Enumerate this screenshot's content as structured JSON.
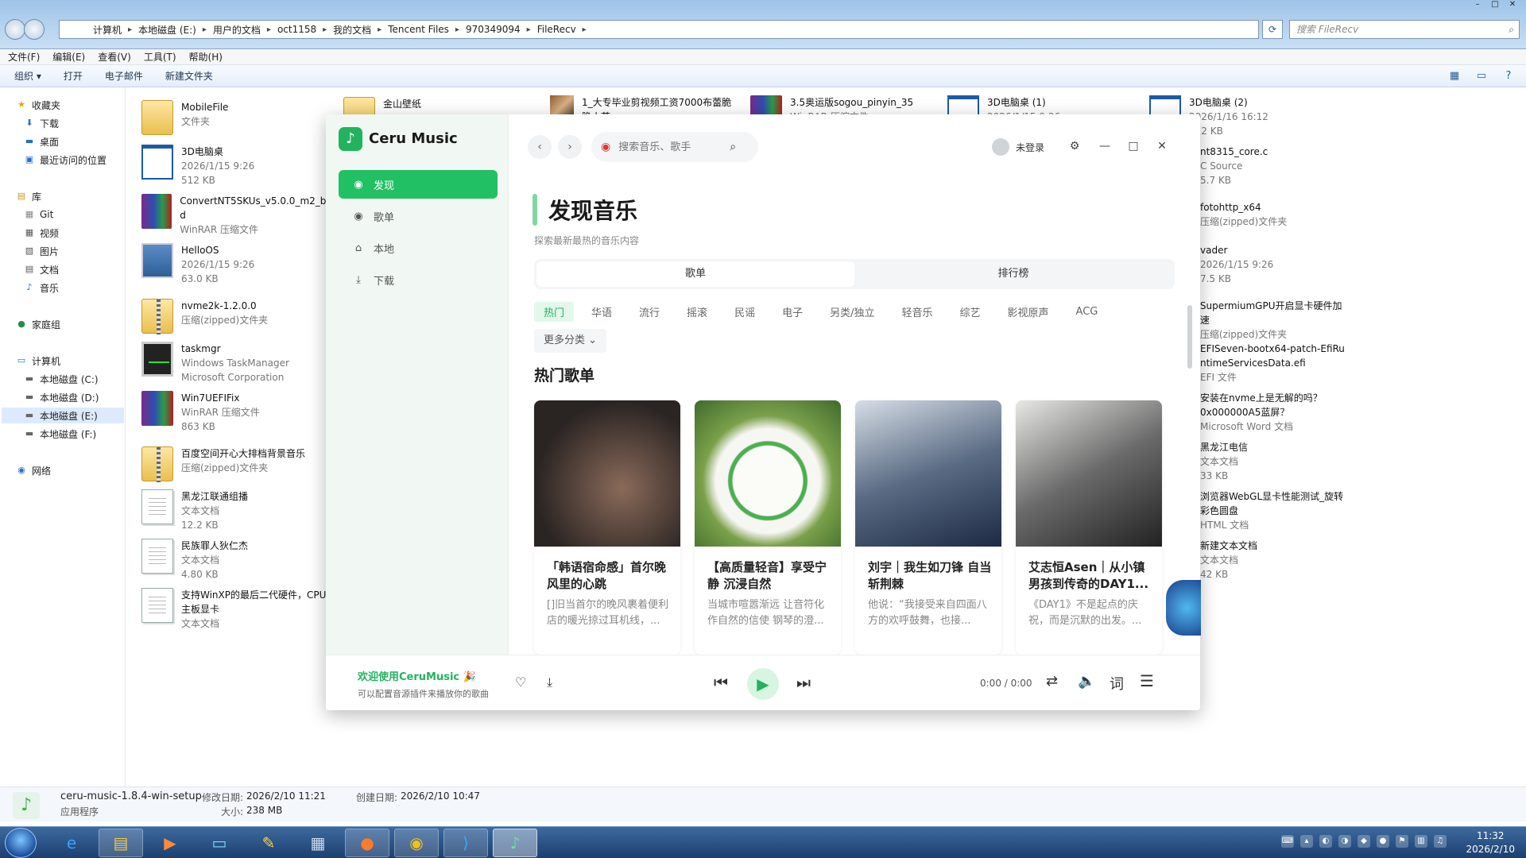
{
  "explorer": {
    "breadcrumbs": [
      "计算机",
      "本地磁盘 (E:)",
      "用户的文档",
      "oct1158",
      "我的文档",
      "Tencent Files",
      "970349094",
      "FileRecv"
    ],
    "search_placeholder": "搜索 FileRecv",
    "menu": [
      "文件(F)",
      "编辑(E)",
      "查看(V)",
      "工具(T)",
      "帮助(H)"
    ],
    "toolbar": [
      "组织 ▾",
      "打开",
      "电子邮件",
      "新建文件夹"
    ],
    "nav": {
      "favorites": "收藏夹",
      "downloads": "下载",
      "desktop": "桌面",
      "recent": "最近访问的位置",
      "libraries": "库",
      "git": "Git",
      "video": "视频",
      "pictures": "图片",
      "documents": "文档",
      "music": "音乐",
      "homegroup": "家庭组",
      "computer": "计算机",
      "drive_c": "本地磁盘 (C:)",
      "drive_d": "本地磁盘 (D:)",
      "drive_e": "本地磁盘 (E:)",
      "drive_f": "本地磁盘 (F:)",
      "network": "网络"
    },
    "files_col1": [
      {
        "name": "MobileFile",
        "meta1": "文件夹",
        "meta2": "",
        "icon": "folder"
      },
      {
        "name": "3D电脑桌",
        "meta1": "2026/1/15 9:26",
        "meta2": "512 KB",
        "icon": "window"
      },
      {
        "name": "ConvertNT5SKUs_v5.0.0_m2_bu",
        "meta1": "d",
        "meta2": "WinRAR 压缩文件",
        "icon": "rar"
      },
      {
        "name": "HelloOS",
        "meta1": "2026/1/15 9:26",
        "meta2": "63.0 KB",
        "icon": "hello"
      },
      {
        "name": "nvme2k-1.2.0.0",
        "meta1": "压缩(zipped)文件夹",
        "meta2": "",
        "icon": "zipfolder"
      },
      {
        "name": "taskmgr",
        "meta1": "Windows TaskManager",
        "meta2": "Microsoft Corporation",
        "icon": "task"
      },
      {
        "name": "Win7UEFIFix",
        "meta1": "WinRAR 压缩文件",
        "meta2": "863 KB",
        "icon": "rar"
      },
      {
        "name": "百度空间开心大排档背景音乐",
        "meta1": "压缩(zipped)文件夹",
        "meta2": "",
        "icon": "zipfolder"
      },
      {
        "name": "黑龙江联通组播",
        "meta1": "文本文档",
        "meta2": "12.2 KB",
        "icon": "doc"
      },
      {
        "name": "民族罪人狄仁杰",
        "meta1": "文本文档",
        "meta2": "4.80 KB",
        "icon": "doc"
      },
      {
        "name": "支持WinXP的最后二代硬件，CPU",
        "meta1": "主板显卡",
        "meta2": "文本文档",
        "icon": "doc"
      }
    ],
    "files_top": [
      {
        "name": "金山壁纸",
        "meta1": ""
      },
      {
        "name": "1_大专毕业剪视频工资7000布蕾脆",
        "meta1": "脆小芳"
      },
      {
        "name": "3.5奥运版sogou_pinyin_35",
        "meta1": "WinRAR 压缩文件"
      },
      {
        "name": "3D电脑桌 (1)",
        "meta1": "2026/1/15 9:26"
      },
      {
        "name": "3D电脑桌 (2)",
        "meta1": "2026/1/16 16:12",
        "meta2": "512 KB"
      }
    ],
    "files_right": [
      {
        "name": "nt8315_core.c",
        "meta1": "C Source",
        "meta2": "5.7 KB"
      },
      {
        "name": "fotohttp_x64",
        "meta1": "压缩(zipped)文件夹",
        "meta2": ""
      },
      {
        "name": "vader",
        "meta1": "2026/1/15 9:26",
        "meta2": "7.5 KB"
      },
      {
        "name": "SupermiumGPU开启显卡硬件加速",
        "meta1": "压缩(zipped)文件夹",
        "meta2": ""
      },
      {
        "name": "EFISeven-bootx64-patch-EfiRu",
        "meta1": "ntimeServicesData.efi",
        "meta2": "EFI 文件"
      },
      {
        "name": "安装在nvme上是无解的吗？",
        "meta1": "0x000000A5蓝屏？",
        "meta2": "Microsoft Word 文档"
      },
      {
        "name": "黑龙江电信",
        "meta1": "文本文档",
        "meta2": "33 KB"
      },
      {
        "name": "浏览器WebGL显卡性能测试_旋转",
        "meta1": "彩色圆盘",
        "meta2": "HTML 文档"
      },
      {
        "name": "新建文本文档",
        "meta1": "文本文档",
        "meta2": "42 KB"
      }
    ],
    "status": {
      "filename": "ceru-music-1.8.4-win-setup",
      "modified_label": "修改日期:",
      "modified": "2026/2/10 11:21",
      "created_label": "创建日期:",
      "created": "2026/2/10 10:47",
      "type": "应用程序",
      "size_label": "大小:",
      "size": "238 MB"
    }
  },
  "taskbar": {
    "time": "11:32",
    "date": "2026/2/10"
  },
  "ceru": {
    "app_name": "Ceru Music",
    "sidebar": [
      {
        "label": "发现",
        "active": true
      },
      {
        "label": "歌单",
        "active": false
      },
      {
        "label": "本地",
        "active": false
      },
      {
        "label": "下载",
        "active": false
      }
    ],
    "search_placeholder": "搜索音乐、歌手",
    "user_label": "未登录",
    "title": "发现音乐",
    "subtitle": "探索最新最热的音乐内容",
    "tabs": [
      {
        "label": "歌单",
        "active": true
      },
      {
        "label": "排行榜",
        "active": false
      }
    ],
    "categories": [
      "热门",
      "华语",
      "流行",
      "摇滚",
      "民谣",
      "电子",
      "另类/独立",
      "轻音乐",
      "综艺",
      "影视原声",
      "ACG"
    ],
    "more_categories": "更多分类",
    "section_title": "热门歌单",
    "cards": [
      {
        "title": "「韩语宿命感」首尔晚风里的心跳",
        "desc": "[]旧当首尔的晚风裹着便利店的暖光掠过耳机线，..."
      },
      {
        "title": "【高质量轻音】享受宁静 沉浸自然",
        "desc": "当城市喧嚣渐远 让音符化作自然的信使 钢琴的澄..."
      },
      {
        "title": "刘宇｜我生如刀锋 自当斩荆棘",
        "desc": "他说：“我接受来自四面八方的欢呼鼓舞，也接..."
      },
      {
        "title": "艾志恒Asen｜从小镇男孩到传奇的DAY1...",
        "desc": "《DAY1》不是起点的庆祝，而是沉默的出发。..."
      }
    ],
    "player": {
      "welcome": "欢迎使用CeruMusic 🎉",
      "welcome_sub": "可以配置音源插件来播放你的歌曲",
      "time": "0:00 / 0:00"
    },
    "accent": "#22c064"
  }
}
